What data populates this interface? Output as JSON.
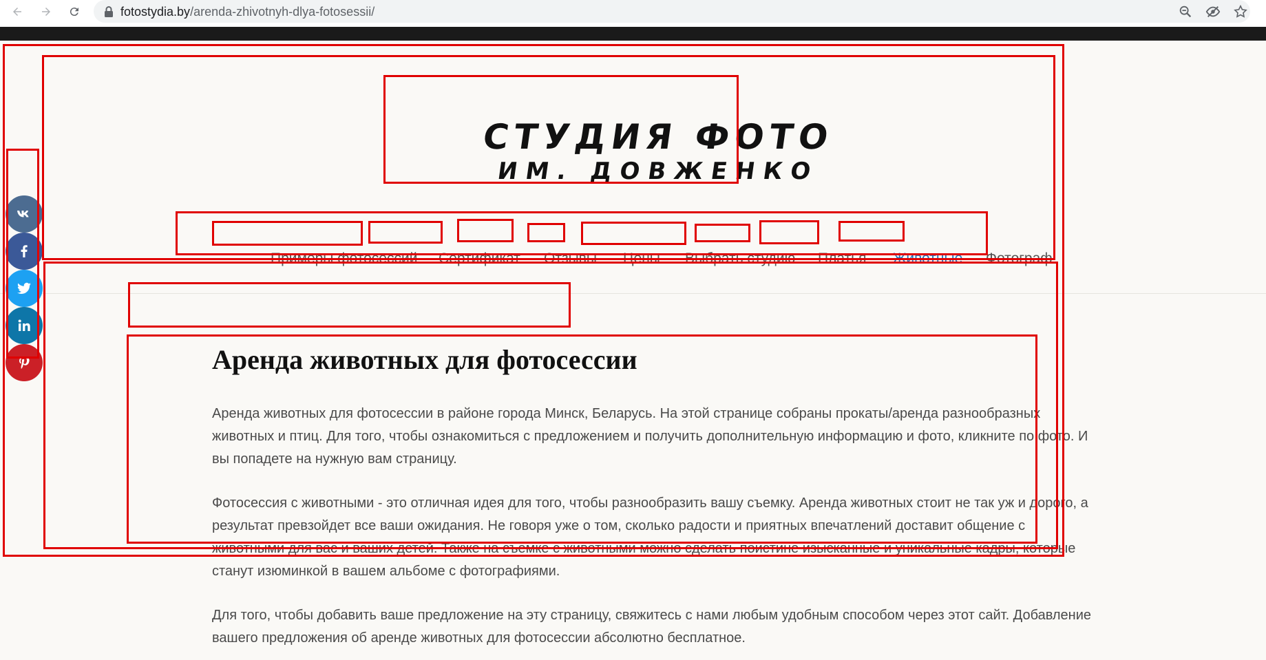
{
  "browser": {
    "url_domain": "fotostydia.by",
    "url_path": "/arenda-zhivotnyh-dlya-fotosessii/"
  },
  "site": {
    "logo_line1": "СТУДИЯ ФОТО",
    "logo_line2": "ИМ. ДОВЖЕНКО"
  },
  "nav": {
    "items": [
      {
        "label": "Примеры фотосессий",
        "active": false
      },
      {
        "label": "Сертификат",
        "active": false
      },
      {
        "label": "Отзывы",
        "active": false
      },
      {
        "label": "Цены",
        "active": false
      },
      {
        "label": "Выбрать студию",
        "active": false
      },
      {
        "label": "Платья",
        "active": false
      },
      {
        "label": "Животные",
        "active": true
      },
      {
        "label": "Фотограф",
        "active": false
      }
    ]
  },
  "social": [
    {
      "icon": "vk-icon",
      "color": "#4c6c91"
    },
    {
      "icon": "facebook-icon",
      "color": "#3b5998"
    },
    {
      "icon": "twitter-icon",
      "color": "#1da1f2"
    },
    {
      "icon": "linkedin-icon",
      "color": "#0e76a8"
    },
    {
      "icon": "pinterest-icon",
      "color": "#cb2027"
    }
  ],
  "main": {
    "title": "Аренда животных для фотосессии",
    "paragraphs": [
      "Аренда животных для фотосессии в районе города Минск, Беларусь. На этой странице собраны прокаты/аренда разнообразных животных и птиц. Для того, чтобы ознакомиться с предложением и получить дополнительную информацию и фото, кликните по фото. И вы попадете на нужную вам страницу.",
      "Фотосессия с животными - это отличная идея для того, чтобы разнообразить вашу съемку. Аренда животных стоит не так уж и дорого, а результат превзойдет все ваши ожидания. Не говоря уже о том, сколько радости и приятных впечатлений доставит общение с животными для вас и ваших детей. Также на съемке с животными можно сделать поистине изысканные и уникальные кадры, которые станут изюминкой в вашем альбоме с фотографиями.",
      "Для того, чтобы добавить ваше предложение на эту страницу, свяжитесь с нами любым удобным способом через этот сайт. Добавление вашего предложения об аренде животных для фотосессии абсолютно бесплатное."
    ]
  },
  "colors": {
    "annotation": "#e00000",
    "active_link": "#1e73be",
    "page_bg": "#faf9f6"
  }
}
